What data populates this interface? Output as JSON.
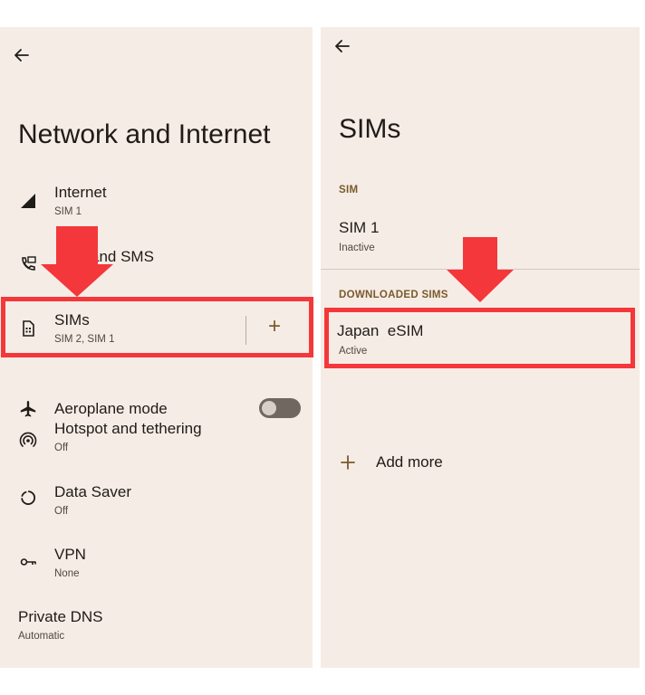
{
  "left": {
    "title": "Network and Internet",
    "items": [
      {
        "id": "internet",
        "label": "Internet",
        "sub": "SIM 1",
        "icon": "signal-icon"
      },
      {
        "id": "calls",
        "label": "and SMS",
        "sub": "",
        "icon": "phone-icon"
      },
      {
        "id": "sims",
        "label": "SIMs",
        "sub": "SIM 2, SIM 1",
        "icon": "sim-card-icon",
        "action": "+"
      },
      {
        "id": "aeroplane",
        "label": "Aeroplane mode",
        "sub": "",
        "icon": "airplane-icon",
        "toggle": "off"
      },
      {
        "id": "hotspot",
        "label": "Hotspot and tethering",
        "sub": "Off",
        "icon": "hotspot-icon"
      },
      {
        "id": "datasaver",
        "label": "Data Saver",
        "sub": "Off",
        "icon": "data-saver-icon"
      },
      {
        "id": "vpn",
        "label": "VPN",
        "sub": "None",
        "icon": "vpn-key-icon"
      },
      {
        "id": "dns",
        "label": "Private DNS",
        "sub": "Automatic",
        "icon": ""
      }
    ]
  },
  "right": {
    "title": "SIMs",
    "section_sim": "SIM",
    "sim1": {
      "label": "SIM 1",
      "sub": "Inactive"
    },
    "section_downloaded": "DOWNLOADED SIMS",
    "esim": {
      "label": "Japan  eSIM",
      "sub": "Active"
    },
    "add_more": {
      "label": "Add more",
      "icon": "plus-icon"
    }
  },
  "colors": {
    "panel_bg": "#f6ece6",
    "highlight": "#f4373a",
    "accent": "#7a5a2b"
  }
}
